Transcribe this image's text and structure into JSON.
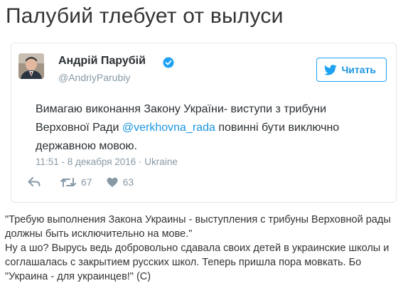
{
  "page": {
    "title": "Палубий тлебует от вылуси"
  },
  "tweet": {
    "author_name": "Андрій Парубій",
    "author_handle": "@AndriyParubiy",
    "follow_button_label": "Читать",
    "text_part1": "Вимагаю виконання Закону України- виступи з трибуни Верховної Ради ",
    "mention": "@verkhovna_rada",
    "text_part2": " повинні бути виключно державною мовою.",
    "timestamp": "11:51 - 8 декабря 2016 · Ukraine",
    "retweet_count": "67",
    "like_count": "63"
  },
  "commentary": {
    "paragraph1": "\"Требую выполнения Закона Украины - выступления с трибуны Верховной рады должны быть исключительно на мове.\"",
    "paragraph2": "Ну а шо? Вырусь ведь добровольно сдавала своих детей в украинские школы и соглашалась с закрытием русских школ. Теперь пришла пора мовкать. Бо \"Украина - для украинцев!\" (С)"
  },
  "colors": {
    "accent": "#1da1f2",
    "link": "#1b95e0",
    "muted": "#8899a6",
    "border": "#e1e8ed"
  },
  "icons": [
    "verified-icon",
    "bird-icon",
    "reply-icon",
    "retweet-icon",
    "heart-icon"
  ]
}
